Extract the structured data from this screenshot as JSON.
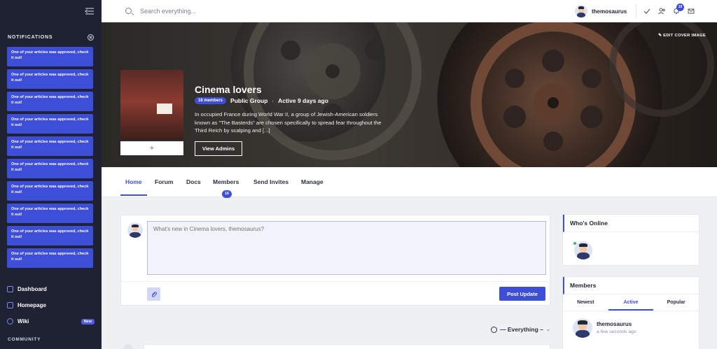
{
  "sidebar": {
    "notifications_title": "NOTIFICATIONS",
    "notifications": [
      "One of your articles was approved, check it out!",
      "One of your articles was approved, check it out!",
      "One of your articles was approved, check it out!",
      "One of your articles was approved, check it out!",
      "One of your articles was approved, check it out!",
      "One of your articles was approved, check it out!",
      "One of your articles was approved, check it out!",
      "One of your articles was approved, check it out!",
      "One of your articles was approved, check it out!",
      "One of your articles was approved, check it out!"
    ],
    "nav": [
      {
        "label": "Dashboard",
        "icon": "dashboard-icon"
      },
      {
        "label": "Homepage",
        "icon": "homepage-icon"
      },
      {
        "label": "Wiki",
        "icon": "globe-icon",
        "badge": "New"
      }
    ],
    "community_title": "COMMUNITY"
  },
  "topbar": {
    "search_placeholder": "Search everything...",
    "user_name": "themosaurus",
    "notification_count": "10"
  },
  "cover": {
    "edit_label": "EDIT COVER IMAGE",
    "thumb_add": "+",
    "group_name": "Cinema lovers",
    "members_pill": "16 members",
    "privacy": "Public Group",
    "separator": "·",
    "active": "Active 9 days ago",
    "description": "In occupied France during World War II, a group of Jewish-American soldiers known as \"The Basterds\" are chosen specifically to spread fear throughout the Third Reich by scalping and [...]",
    "view_admins": "View Admins"
  },
  "tabs": [
    {
      "label": "Home",
      "active": true
    },
    {
      "label": "Forum"
    },
    {
      "label": "Docs"
    },
    {
      "label": "Members",
      "count": "16"
    },
    {
      "label": "Send Invites"
    },
    {
      "label": "Manage"
    }
  ],
  "post": {
    "placeholder": "What's new in Cinema lovers, themosaurus?",
    "submit": "Post Update"
  },
  "filter": {
    "label": "— Everything –"
  },
  "whos_online": {
    "title": "Who's Online"
  },
  "members_widget": {
    "title": "Members",
    "tabs": [
      "Newest",
      "Active",
      "Popular"
    ],
    "items": [
      {
        "name": "themosaurus",
        "time": "a few seconds ago"
      }
    ]
  },
  "colors": {
    "accent": "#3d4ed8",
    "sidebar": "#1f2233"
  }
}
